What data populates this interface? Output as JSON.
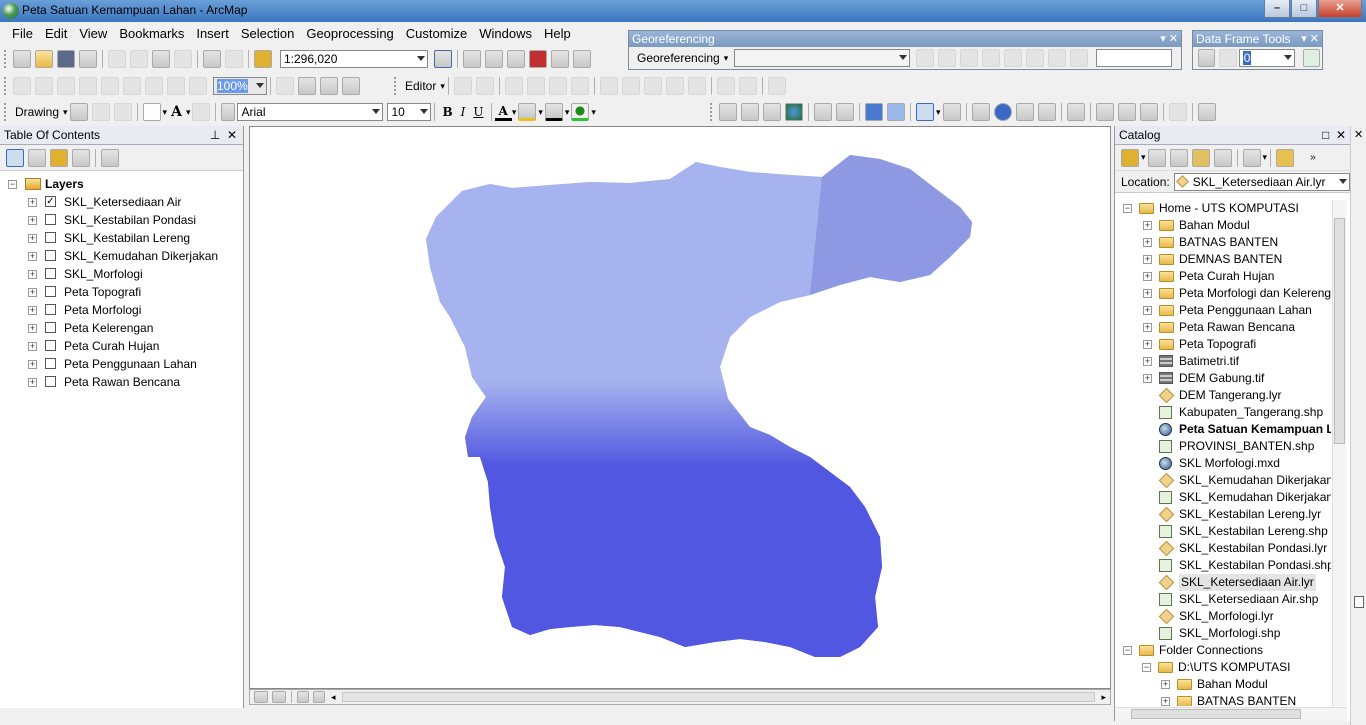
{
  "window": {
    "title": "Peta Satuan Kemampuan Lahan - ArcMap"
  },
  "menu": [
    "File",
    "Edit",
    "View",
    "Bookmarks",
    "Insert",
    "Selection",
    "Geoprocessing",
    "Customize",
    "Windows",
    "Help"
  ],
  "standard_toolbar": {
    "scale": "1:296,020"
  },
  "georeferencing": {
    "title": "Georeferencing",
    "menu_label": "Georeferencing"
  },
  "data_frame_tools": {
    "title": "Data Frame Tools",
    "value": "0"
  },
  "editor_toolbar": {
    "label": "Editor",
    "zoom_value": "100%"
  },
  "drawing_toolbar": {
    "label": "Drawing",
    "font_name": "Arial",
    "font_size": "10",
    "bold": "B",
    "italic": "I",
    "underline": "U",
    "text_tool": "A"
  },
  "toc": {
    "title": "Table Of Contents",
    "root": "Layers",
    "layers": [
      {
        "name": "SKL_Ketersediaan Air",
        "checked": true
      },
      {
        "name": "SKL_Kestabilan Pondasi",
        "checked": false
      },
      {
        "name": "SKL_Kestabilan Lereng",
        "checked": false
      },
      {
        "name": "SKL_Kemudahan Dikerjakan",
        "checked": false
      },
      {
        "name": "SKL_Morfologi",
        "checked": false
      },
      {
        "name": "Peta Topografi",
        "checked": false
      },
      {
        "name": "Peta Morfologi",
        "checked": false
      },
      {
        "name": "Peta Kelerengan",
        "checked": false
      },
      {
        "name": "Peta Curah Hujan",
        "checked": false
      },
      {
        "name": "Peta Penggunaan Lahan",
        "checked": false
      },
      {
        "name": "Peta Rawan Bencana",
        "checked": false
      }
    ]
  },
  "map": {
    "fill_north": "#a7b3ee",
    "fill_south": "#5157e0",
    "fill_ridge": "#7b82d8"
  },
  "catalog": {
    "title": "Catalog",
    "location_label": "Location:",
    "location_value": "SKL_Ketersediaan Air.lyr",
    "home": "Home - UTS KOMPUTASI",
    "items": [
      {
        "name": "Bahan Modul",
        "type": "folder",
        "expandable": true
      },
      {
        "name": "BATNAS BANTEN",
        "type": "folder",
        "expandable": true
      },
      {
        "name": "DEMNAS BANTEN",
        "type": "folder",
        "expandable": true
      },
      {
        "name": "Peta Curah Hujan",
        "type": "folder",
        "expandable": true
      },
      {
        "name": "Peta Morfologi dan Kelereng",
        "type": "folder",
        "expandable": true
      },
      {
        "name": "Peta Penggunaan Lahan",
        "type": "folder",
        "expandable": true
      },
      {
        "name": "Peta Rawan Bencana",
        "type": "folder",
        "expandable": true
      },
      {
        "name": "Peta Topografi",
        "type": "folder",
        "expandable": true
      },
      {
        "name": "Batimetri.tif",
        "type": "raster",
        "expandable": true
      },
      {
        "name": "DEM Gabung.tif",
        "type": "raster",
        "expandable": true
      },
      {
        "name": "DEM Tangerang.lyr",
        "type": "lyr",
        "expandable": false
      },
      {
        "name": "Kabupaten_Tangerang.shp",
        "type": "shp",
        "expandable": false
      },
      {
        "name": "Peta Satuan Kemampuan La",
        "type": "mxd",
        "expandable": false,
        "bold": true
      },
      {
        "name": "PROVINSI_BANTEN.shp",
        "type": "shp",
        "expandable": false
      },
      {
        "name": "SKL Morfologi.mxd",
        "type": "mxd",
        "expandable": false
      },
      {
        "name": "SKL_Kemudahan Dikerjakan.",
        "type": "lyr",
        "expandable": false
      },
      {
        "name": "SKL_Kemudahan Dikerjakan.",
        "type": "shp",
        "expandable": false
      },
      {
        "name": "SKL_Kestabilan Lereng.lyr",
        "type": "lyr",
        "expandable": false
      },
      {
        "name": "SKL_Kestabilan Lereng.shp",
        "type": "shp",
        "expandable": false
      },
      {
        "name": "SKL_Kestabilan Pondasi.lyr",
        "type": "lyr",
        "expandable": false
      },
      {
        "name": "SKL_Kestabilan Pondasi.shp",
        "type": "shp",
        "expandable": false
      },
      {
        "name": "SKL_Ketersediaan Air.lyr",
        "type": "lyr",
        "expandable": false,
        "selected": true
      },
      {
        "name": "SKL_Ketersediaan Air.shp",
        "type": "shp",
        "expandable": false
      },
      {
        "name": "SKL_Morfologi.lyr",
        "type": "lyr",
        "expandable": false
      },
      {
        "name": "SKL_Morfologi.shp",
        "type": "shp",
        "expandable": false
      }
    ],
    "folder_connections": "Folder Connections",
    "connection": "D:\\UTS KOMPUTASI",
    "connection_items": [
      "Bahan Modul",
      "BATNAS BANTEN"
    ]
  }
}
